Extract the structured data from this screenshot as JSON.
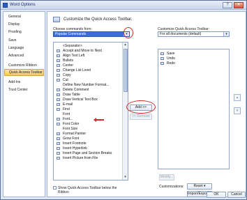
{
  "window": {
    "title": "Word Options",
    "help_label": "?",
    "close_label": "✕"
  },
  "sidebar": {
    "items": [
      {
        "label": "General"
      },
      {
        "label": "Display"
      },
      {
        "label": "Proofing"
      },
      {
        "label": "Save"
      },
      {
        "label": "Language"
      },
      {
        "label": "Advanced"
      },
      {
        "label": "Customize Ribbon"
      },
      {
        "label": "Quick Access Toolbar"
      },
      {
        "label": "Add-Ins"
      },
      {
        "label": "Trust Center"
      }
    ]
  },
  "header": {
    "title": "Customize the Quick Access Toolbar."
  },
  "left": {
    "choose_label": "Choose commands from:",
    "choose_value": "Popular Commands",
    "commands": [
      "<Separator>",
      "Accept and Move to Next",
      "Align Text Left",
      "Bullets",
      "Center",
      "Change List Level",
      "Copy",
      "Cut",
      "Define New Number Format...",
      "Delete Comment",
      "Draw Table",
      "Draw Vertical Text Box",
      "E-mail",
      "Find",
      "Font",
      "Font...",
      "Font Color",
      "Font Size",
      "Format Painter",
      "Grow Font",
      "Insert Footnote",
      "Insert Hyperlink",
      "Insert Page and Section Breaks",
      "Insert Picture from File"
    ],
    "show_below_label": "Show Quick Access Toolbar below the Ribbon"
  },
  "middle": {
    "add_label": "Add >>",
    "remove_label": "<< Remove"
  },
  "right": {
    "customize_label": "Customize Quick Access Toolbar:",
    "customize_value": "For all documents (default)",
    "items": [
      "Save",
      "Undo",
      "Redo"
    ],
    "modify_label": "Modify...",
    "customizations_label": "Customizations:",
    "reset_label": "Reset ▾",
    "import_export_label": "Import/Export ▾"
  },
  "footer": {
    "ok_label": "OK",
    "cancel_label": "Cancel"
  },
  "colors": {
    "highlight": "#3b6fd6",
    "annotation": "#d12a2a",
    "active_nav": "#f5c85b"
  }
}
